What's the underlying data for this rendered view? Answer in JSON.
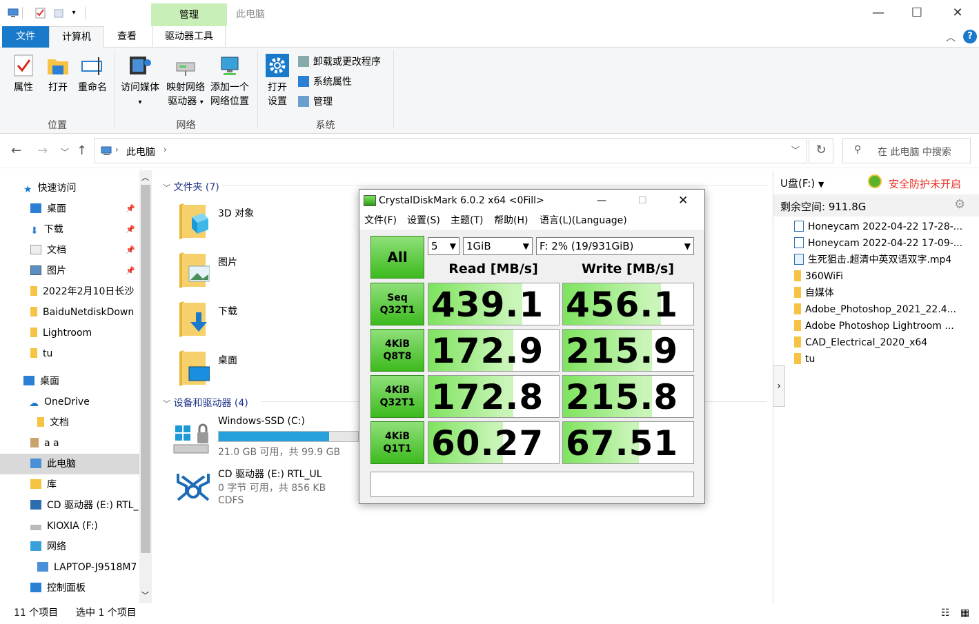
{
  "titlebar": {
    "context_tab": "管理",
    "title": "此电脑"
  },
  "tabs": {
    "file": "文件",
    "computer": "计算机",
    "view": "查看",
    "drive_tools": "驱动器工具"
  },
  "ribbon": {
    "location": {
      "group": "位置",
      "properties": "属性",
      "open": "打开",
      "rename": "重命名"
    },
    "network": {
      "group": "网络",
      "access_media": "访问媒体",
      "map_drive_1": "映射网络",
      "map_drive_2": "驱动器",
      "add_location_1": "添加一个",
      "add_location_2": "网络位置"
    },
    "system": {
      "group": "系统",
      "open_settings_1": "打开",
      "open_settings_2": "设置",
      "uninstall": "卸载或更改程序",
      "sys_props": "系统属性",
      "manage": "管理"
    }
  },
  "address": {
    "path": "此电脑",
    "search_placeholder": "在 此电脑 中搜索"
  },
  "sidebar": {
    "items": [
      {
        "label": "快速访问"
      },
      {
        "label": "桌面"
      },
      {
        "label": "下载"
      },
      {
        "label": "文档"
      },
      {
        "label": "图片"
      },
      {
        "label": "2022年2月10日长沙"
      },
      {
        "label": "BaiduNetdiskDown"
      },
      {
        "label": "Lightroom"
      },
      {
        "label": "tu"
      },
      {
        "label": "桌面"
      },
      {
        "label": "OneDrive"
      },
      {
        "label": "文档"
      },
      {
        "label": "a a"
      },
      {
        "label": "此电脑"
      },
      {
        "label": "库"
      },
      {
        "label": "CD 驱动器 (E:) RTL_"
      },
      {
        "label": "KIOXIA (F:)"
      },
      {
        "label": "网络"
      },
      {
        "label": "LAPTOP-J9518M7"
      },
      {
        "label": "控制面板"
      }
    ]
  },
  "content": {
    "folders_header": "文件夹 (7)",
    "folders": [
      "3D 对象",
      "图片",
      "下载",
      "桌面"
    ],
    "devices_header": "设备和驱动器 (4)",
    "drive_c": {
      "name": "Windows-SSD (C:)",
      "free": "21.0 GB 可用，共 99.9 GB",
      "used_fraction": 0.79
    },
    "drive_e": {
      "name": "CD 驱动器 (E:) RTL_UL",
      "free": "0 字节 可用，共 856 KB",
      "fs": "CDFS"
    }
  },
  "right_panel": {
    "drive": "U盘(F:)",
    "security": "安全防护未开启",
    "free_space": "剩余空间: 911.8G",
    "files": [
      "Honeycam 2022-04-22 17-28-...",
      "Honeycam 2022-04-22 17-09-...",
      "生死狙击.超清中英双语双字.mp4",
      "360WiFi",
      "自媒体",
      "Adobe_Photoshop_2021_22.4...",
      "Adobe Photoshop Lightroom ...",
      "CAD_Electrical_2020_x64",
      "tu"
    ]
  },
  "status": {
    "count": "11 个项目",
    "selected": "选中 1 个项目"
  },
  "cdm": {
    "title": "CrystalDiskMark 6.0.2 x64 <0Fill>",
    "menu": [
      "文件(F)",
      "设置(S)",
      "主题(T)",
      "帮助(H)",
      "语言(L)(Language)"
    ],
    "all_button": "All",
    "count": "5",
    "size": "1GiB",
    "drive": "F: 2% (19/931GiB)",
    "read_header": "Read [MB/s]",
    "write_header": "Write [MB/s]",
    "rows": [
      {
        "l1": "Seq",
        "l2": "Q32T1",
        "read": "439.1",
        "write": "456.1",
        "read_fill": 0.72,
        "write_fill": 0.75
      },
      {
        "l1": "4KiB",
        "l2": "Q8T8",
        "read": "172.9",
        "write": "215.9",
        "read_fill": 0.65,
        "write_fill": 0.68
      },
      {
        "l1": "4KiB",
        "l2": "Q32T1",
        "read": "172.8",
        "write": "215.8",
        "read_fill": 0.65,
        "write_fill": 0.68
      },
      {
        "l1": "4KiB",
        "l2": "Q1T1",
        "read": "60.27",
        "write": "67.51",
        "read_fill": 0.57,
        "write_fill": 0.58
      }
    ]
  }
}
